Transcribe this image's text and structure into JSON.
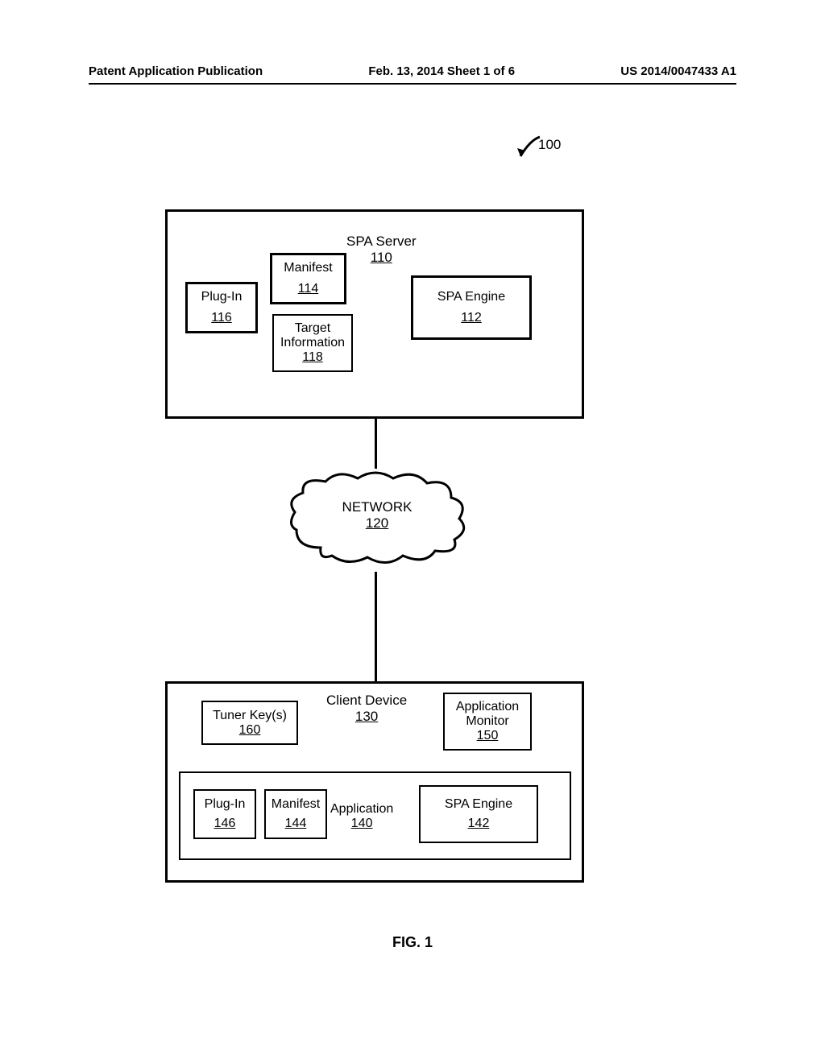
{
  "header": {
    "left": "Patent Application Publication",
    "center": "Feb. 13, 2014  Sheet 1 of 6",
    "right": "US 2014/0047433 A1"
  },
  "fig_ref": "100",
  "spa_server": {
    "title": "SPA Server",
    "ref": "110"
  },
  "plugin": {
    "title": "Plug-In",
    "ref": "116"
  },
  "manifest": {
    "title": "Manifest",
    "ref": "114"
  },
  "target_info": {
    "title": "Target Information",
    "ref": "118"
  },
  "spa_engine": {
    "title": "SPA Engine",
    "ref": "112"
  },
  "network": {
    "title": "NETWORK",
    "ref": "120"
  },
  "client": {
    "title": "Client Device",
    "ref": "130"
  },
  "tuner": {
    "title": "Tuner Key(s)",
    "ref": "160"
  },
  "app_monitor": {
    "title": "Application Monitor",
    "ref": "150"
  },
  "application": {
    "title": "Application",
    "ref": "140"
  },
  "plugin2": {
    "title": "Plug-In",
    "ref": "146"
  },
  "manifest2": {
    "title": "Manifest",
    "ref": "144"
  },
  "spa_engine2": {
    "title": "SPA Engine",
    "ref": "142"
  },
  "figure_label": "FIG. 1"
}
